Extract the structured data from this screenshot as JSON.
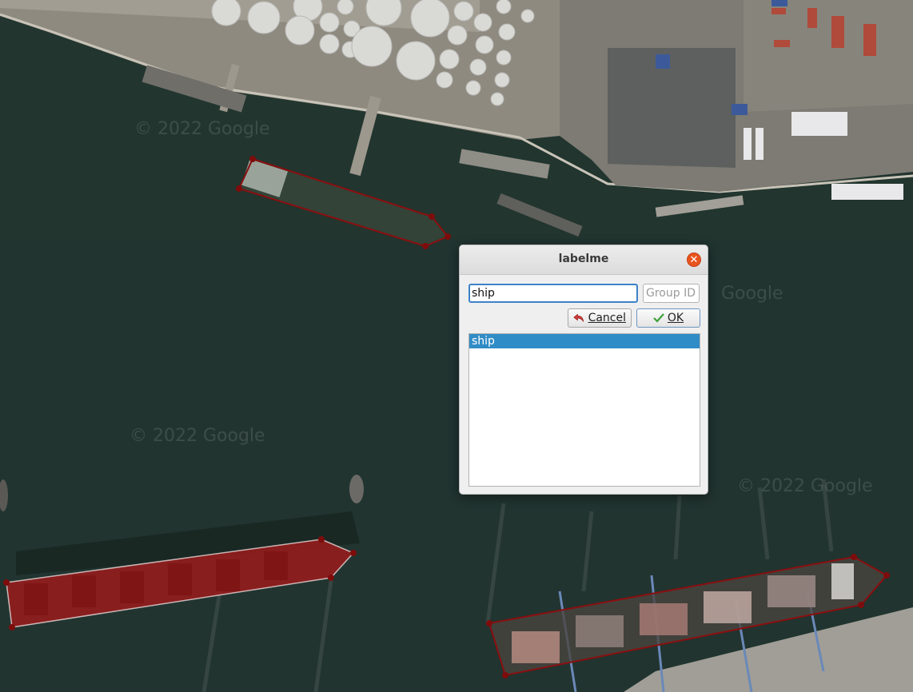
{
  "dialog": {
    "title": "labelme",
    "label_input_value": "ship",
    "group_id_placeholder": "Group ID",
    "cancel_label": "Cancel",
    "ok_label": "OK",
    "label_list": [
      {
        "text": "ship",
        "selected": true
      }
    ]
  },
  "canvas": {
    "watermarks": [
      "© 2022 Google",
      "© 2022 Google",
      "Google",
      "© 2022 Google"
    ],
    "annotations": [
      {
        "label": "ship",
        "state": "unfilled"
      },
      {
        "label": "ship",
        "state": "filled"
      },
      {
        "label": "ship",
        "state": "unfilled"
      }
    ]
  },
  "colors": {
    "water": "#22352f",
    "polygon_stroke": "#8a0f0f",
    "polygon_fill": "#9b1b1b",
    "close_button": "#e9541f",
    "selection": "#308cc6"
  },
  "icons": {
    "close": "close-icon",
    "cancel": "undo-arrow-icon",
    "ok": "checkmark-icon"
  }
}
